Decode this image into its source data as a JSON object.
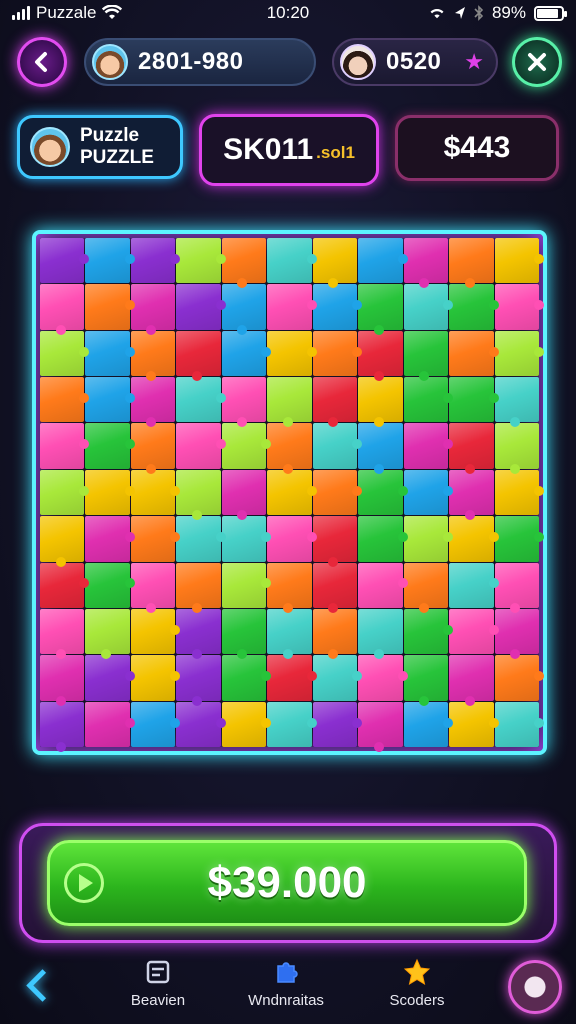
{
  "status_bar": {
    "carrier": "Puzzale",
    "time": "10:20",
    "battery": "89%",
    "battery_level": 0.89
  },
  "header": {
    "back_icon": "chevron-left-icon",
    "player_score": "2801-980",
    "opponent_score": "0520",
    "close_icon": "close-icon"
  },
  "info_row": {
    "puzzle_title": "Puzzle",
    "puzzle_subtitle": "PUZZLE",
    "skill_main": "SK011",
    "skill_sub": ".sol1",
    "cash": "$443"
  },
  "board": {
    "rows": 11,
    "cols": 11,
    "palette": [
      "#f4c400",
      "#e02fb0",
      "#1fa3e8",
      "#27c43a",
      "#ff7a1a",
      "#8a2fd0",
      "#e8273a",
      "#46d1c8",
      "#a8e83a",
      "#ff4fb4"
    ]
  },
  "prize_button": {
    "label": "$39.000"
  },
  "bottom_nav": {
    "item1": "Beavien",
    "item2": "Wndnraitas",
    "item3": "Scoders"
  },
  "colors": {
    "accent_cyan": "#5cf4ff",
    "accent_magenta": "#e043ec",
    "accent_green": "#5ee43a"
  }
}
